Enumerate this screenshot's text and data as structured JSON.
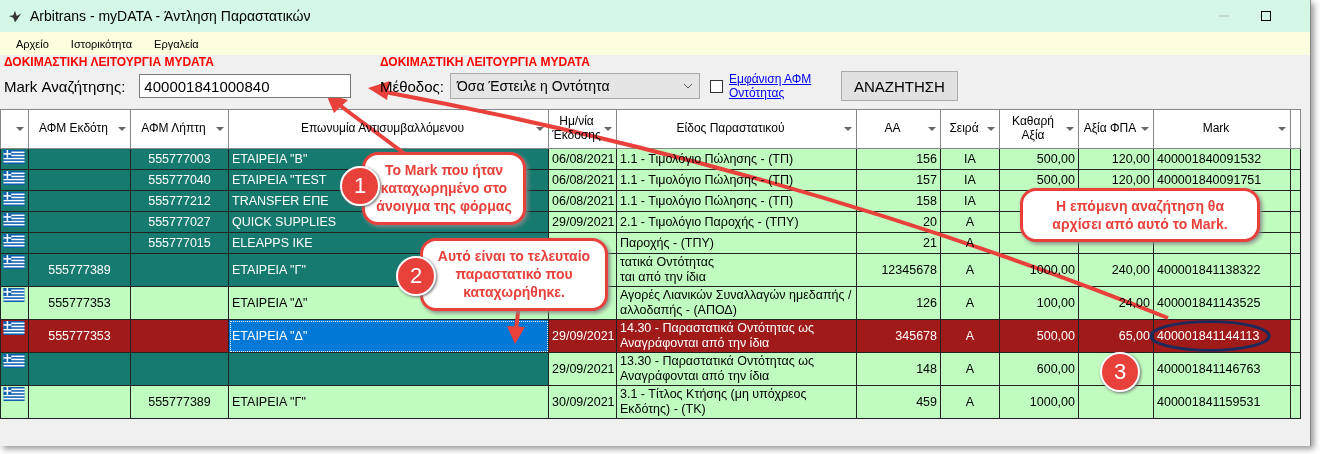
{
  "window": {
    "title": "Arbitrans - myDATA - Άντληση Παραστατικών"
  },
  "menu": [
    "Αρχείο",
    "Ιστορικότητα",
    "Εργαλεία"
  ],
  "test_mode_labels": [
    "ΔΟΚΙΜΑΣΤΙΚΗ ΛΕΙΤΟΥΡΓΙΑ MYDATA",
    "ΔΟΚΙΜΑΣΤΙΚΗ ΛΕΙΤΟΥΡΓΙΑ MYDATA"
  ],
  "search": {
    "label": "Mark Αναζήτησης:",
    "value": "400001841000840"
  },
  "method": {
    "label": "Μέθοδος:",
    "value": "Όσα Έστειλε η Οντότητα"
  },
  "show_vat": {
    "label": "Εμφάνιση ΑΦΜ Οντότητας",
    "checked": false
  },
  "search_button": "ΑΝΑΖΗΤΗΣΗ",
  "columns": [
    "ΑΦΜ Εκδότη",
    "ΑΦΜ Λήπτη",
    "Επωνυμία Αντισυμβαλλόμενου",
    "Ημ/νία Έκδοσης",
    "Είδος Παραστατικού",
    "ΑΑ",
    "Σειρά",
    "Καθαρή Αξία",
    "Αξία ΦΠΑ",
    "Mark"
  ],
  "rows": [
    {
      "recipient": "555777003",
      "name": "ΕΤΑΙΡΕΙΑ \"B\"",
      "date": "06/08/2021",
      "type": "1.1 - Τιμολόγιο Πώλησης - (ΤΠ)",
      "aa": "156",
      "series": "ΙΑ",
      "net": "500,00",
      "vat": "120,00",
      "mark": "400001840091532",
      "marked": true,
      "selected": false,
      "focused": false
    },
    {
      "recipient": "555777040",
      "name": "ΕΤΑΙΡΕΙΑ \"TEST",
      "date": "06/08/2021",
      "type": "1.1 - Τιμολόγιο Πώλησης - (ΤΠ)",
      "aa": "157",
      "series": "ΙΑ",
      "net": "500,00",
      "vat": "120,00",
      "mark": "400001840091751",
      "marked": true,
      "selected": false,
      "focused": false
    },
    {
      "recipient": "555777212",
      "name": "TRANSFER ΕΠΕ",
      "date": "06/08/2021",
      "type": "1.1 - Τιμολόγιο Πώλησης - (ΤΠ)",
      "aa": "158",
      "series": "ΙΑ",
      "marked": true,
      "selected": false,
      "focused": false
    },
    {
      "recipient": "555777027",
      "name": "QUICK SUPPLIES",
      "date": "29/09/2021",
      "type": "2.1 - Τιμολόγιο Παροχής - (ΤΠΥ)",
      "aa": "20",
      "series": "Α",
      "marked": true,
      "selected": false,
      "focused": false
    },
    {
      "recipient": "555777015",
      "name": "ELEAPPS IKE",
      "type": "Παροχής - (ΤΠΥ)",
      "aa": "21",
      "series": "Α",
      "marked": true,
      "selected": false,
      "focused": false
    },
    {
      "issuer": "555777389",
      "name": "ΕΤΑΙΡΕΙΑ \"Γ\"",
      "type": "τατικά Οντότητας\nται από την ίδια",
      "aa": "12345678",
      "series": "Α",
      "net": "1000,00",
      "vat": "240,00",
      "mark": "400001841138322",
      "marked": true,
      "selected": false,
      "focused": false
    },
    {
      "issuer": "555777353",
      "name": "ΕΤΑΙΡΕΙΑ \"Δ\"",
      "type": "Αγορές Λιανικών Συναλλαγών ημεδαπής / αλλοδαπής - (ΑΠΟΔ)",
      "aa": "126",
      "series": "Α",
      "net": "100,00",
      "vat": "24,00",
      "mark": "400001841143525",
      "marked": false,
      "selected": false,
      "focused": false
    },
    {
      "issuer": "555777353",
      "name": "ΕΤΑΙΡΕΙΑ \"Δ\"",
      "date": "29/09/2021",
      "type": "14.30 - Παραστατικά Οντότητας ως Αναγράφονται από την ίδια",
      "aa": "345678",
      "series": "Α",
      "net": "500,00",
      "vat": "65,00",
      "mark": "400001841144113",
      "marked": false,
      "selected": true,
      "focused": true
    },
    {
      "date": "29/09/2021",
      "type": "13.30 - Παραστατικά Οντότητας ως Αναγράφονται από την ίδια",
      "aa": "148",
      "series": "Α",
      "net": "600,00",
      "mark": "400001841146763",
      "marked": true,
      "selected": false,
      "focused": false
    },
    {
      "recipient": "555777389",
      "name": "ΕΤΑΙΡΕΙΑ \"Γ\"",
      "date": "30/09/2021",
      "type": "3.1 - Τίτλος Κτήσης (μη υπόχρεος Εκδότης) - (ΤΚ)",
      "aa": "459",
      "series": "Α",
      "net": "1000,00",
      "mark": "400001841159531",
      "marked": false,
      "selected": false,
      "focused": false
    }
  ],
  "annotations": [
    {
      "number": "1",
      "text": "Το Mark που ήταν καταχωρημένο στο άνοιγμα της φόρμας"
    },
    {
      "number": "2",
      "text": "Αυτό είναι το τελευταίο παραστατικό που καταχωρήθηκε."
    },
    {
      "number": "3",
      "text": "Η επόμενη αναζήτηση θα αρχίσει από αυτό το Mark."
    }
  ]
}
